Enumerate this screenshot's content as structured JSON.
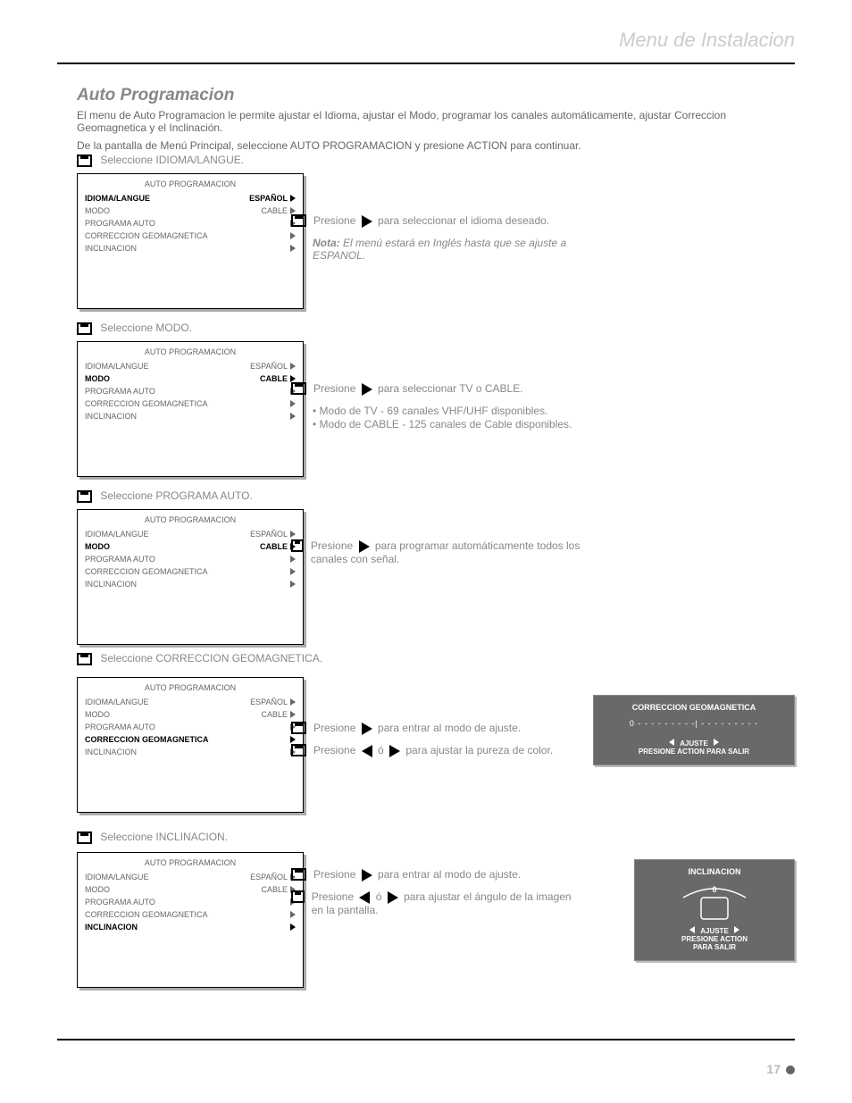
{
  "page": {
    "title_right": "Menu de Instalacion",
    "number": "17"
  },
  "main": {
    "heading": "Auto Programacion",
    "p1": "El menu de Auto Programacion le permite ajustar el Idioma, ajustar el Modo, programar los canales automáticamente, ajustar Correccion Geomagnetica y el Inclinación.",
    "p2": "De la pantalla de Menú Principal, seleccione AUTO PROGRAMACION y presione ACTION para continuar."
  },
  "s1": {
    "label": "Seleccione IDIOMA/LANGUE.",
    "step1": "Presione      para seleccionar el idioma deseado.",
    "note": "El menú estará en Inglés hasta que se ajuste a ESPANOL."
  },
  "s2": {
    "label": "Seleccione MODO.",
    "step1": "Presione      para seleccionar TV o CABLE.",
    "bullet1": "• Modo de TV - 69 canales VHF/UHF disponibles.",
    "bullet2": "• Modo de CABLE - 125 canales de Cable disponibles."
  },
  "s3": {
    "label": "Seleccione PROGRAMA AUTO.",
    "step1": "Presione      para programar automáticamente todos los canales con señal."
  },
  "s4": {
    "label": "Seleccione CORRECCION GEOMAGNETICA.",
    "step1": "Presione      para entrar al modo de ajuste.",
    "step2": "Presione      ó      para ajustar la pureza de color.",
    "box_title": "CORRECCION GEOMAGNETICA",
    "box_scale": "0 - - - - - - -  - -| - - - - - - - - -",
    "ajuste": "AJUSTE",
    "exit": "PRESIONE ACTION PARA SALIR"
  },
  "s5": {
    "label": "Seleccione INCLINACION.",
    "step1": "Presione      para entrar al modo de ajuste.",
    "step2": "Presione      ó      para ajustar el ángulo de la imagen en la pantalla.",
    "box_title": "INCLINACION",
    "zero": "0",
    "ajuste": "AJUSTE",
    "exit1": "PRESIONE  ACTION",
    "exit2": "PARA  SALIR"
  },
  "osd": {
    "title": "AUTO  PROGRAMACION",
    "r1": "IDIOMA/LANGUE",
    "r1v": "ESPAÑOL",
    "r2": "MODO",
    "r2v": "CABLE",
    "r3": "PROGRAMA  AUTO",
    "r4": "CORRECCION GEOMAGNETICA",
    "r5": "INCLINACION"
  }
}
